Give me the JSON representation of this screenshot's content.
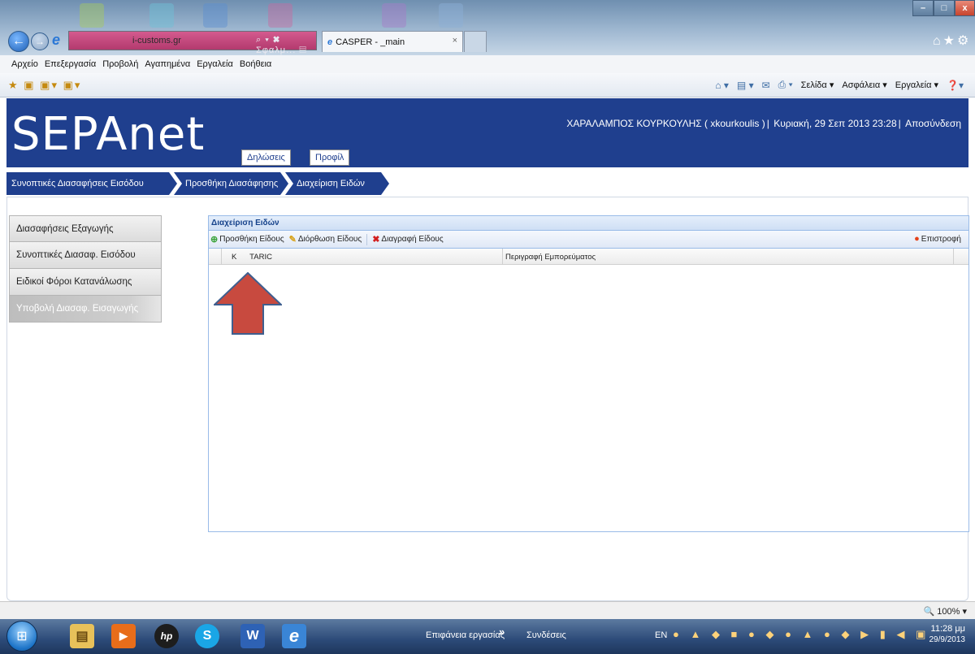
{
  "browser": {
    "address_url": "i-customs.gr",
    "address_tools": "⌕ ▾ ✖ Σφαλμ... ▤ C ✕",
    "active_tab": "CASPER - _main",
    "tab_close": "×",
    "menu": [
      "Αρχείο",
      "Επεξεργασία",
      "Προβολή",
      "Αγαπημένα",
      "Εργαλεία",
      "Βοήθεια"
    ],
    "command_bar": [
      "Σελίδα ▾",
      "Ασφάλεια ▾",
      "Εργαλεία ▾"
    ],
    "zoom": "100%"
  },
  "header": {
    "logo": "SEPAnet",
    "nav_declarations": "Δηλώσεις",
    "nav_profile": "Προφίλ",
    "user": "ΧΑΡΑΛΑΜΠΟΣ ΚΟΥΡΚΟΥΛΗΣ ( xkourkoulis )",
    "date": "Κυριακή, 29 Σεπ 2013 23:28",
    "logout": "Αποσύνδεση",
    "sep": "|"
  },
  "breadcrumb": [
    "Συνοπτικές Διασαφήσεις Εισόδου",
    "Προσθήκη Διασάφησης",
    "Διαχείριση Ειδών"
  ],
  "sidebar": {
    "items": [
      {
        "label": "Διασαφήσεις Εξαγωγής"
      },
      {
        "label": "Συνοπτικές Διασαφ. Εισόδου"
      },
      {
        "label": "Ειδικοί Φόροι Κατανάλωσης"
      },
      {
        "label": "Υποβολή Διασαφ. Εισαγωγής"
      }
    ]
  },
  "panel": {
    "title": "Διαχείριση Ειδών",
    "toolbar": {
      "add": "Προσθήκη Είδους",
      "edit": "Διόρθωση Είδους",
      "delete": "Διαγραφή Είδους",
      "return": "Επιστροφή"
    },
    "columns": {
      "taric": "Κ      TARIC",
      "description": "Περιγραφή Εμπορεύματος"
    }
  },
  "taskbar": {
    "desktop": "Επιφάνεια εργασίας",
    "double_arrow": "»",
    "links": "Συνδέσεις",
    "lang": "EN",
    "time": "11:28 μμ",
    "date": "29/9/2013",
    "word_letter": "W",
    "skype_letter": "S",
    "hp_letter": "hp"
  },
  "colors": {
    "brand_blue": "#1f3f8e",
    "annotation_arrow": "#c84a3f"
  }
}
